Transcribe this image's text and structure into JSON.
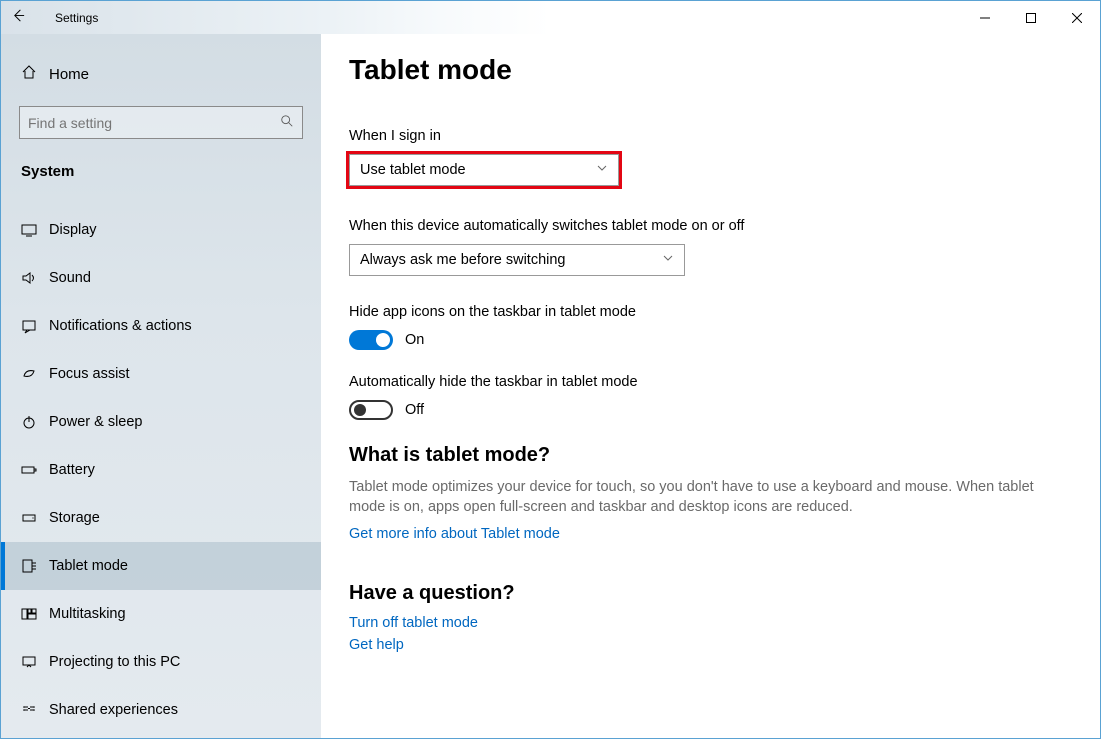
{
  "titlebar": {
    "title": "Settings"
  },
  "sidebar": {
    "home": "Home",
    "search_placeholder": "Find a setting",
    "section": "System",
    "items": [
      {
        "label": "Display"
      },
      {
        "label": "Sound"
      },
      {
        "label": "Notifications & actions"
      },
      {
        "label": "Focus assist"
      },
      {
        "label": "Power & sleep"
      },
      {
        "label": "Battery"
      },
      {
        "label": "Storage"
      },
      {
        "label": "Tablet mode"
      },
      {
        "label": "Multitasking"
      },
      {
        "label": "Projecting to this PC"
      },
      {
        "label": "Shared experiences"
      }
    ]
  },
  "main": {
    "heading": "Tablet mode",
    "sign_in_label": "When I sign in",
    "sign_in_value": "Use tablet mode",
    "auto_switch_label": "When this device automatically switches tablet mode on or off",
    "auto_switch_value": "Always ask me before switching",
    "hide_icons_label": "Hide app icons on the taskbar in tablet mode",
    "hide_icons_state": "On",
    "auto_hide_label": "Automatically hide the taskbar in tablet mode",
    "auto_hide_state": "Off",
    "what_is_heading": "What is tablet mode?",
    "what_is_desc": "Tablet mode optimizes your device for touch, so you don't have to use a keyboard and mouse. When tablet mode is on, apps open full-screen and taskbar and desktop icons are reduced.",
    "more_info_link": "Get more info about Tablet mode",
    "question_heading": "Have a question?",
    "turn_off_link": "Turn off tablet mode",
    "get_help_link": "Get help"
  }
}
